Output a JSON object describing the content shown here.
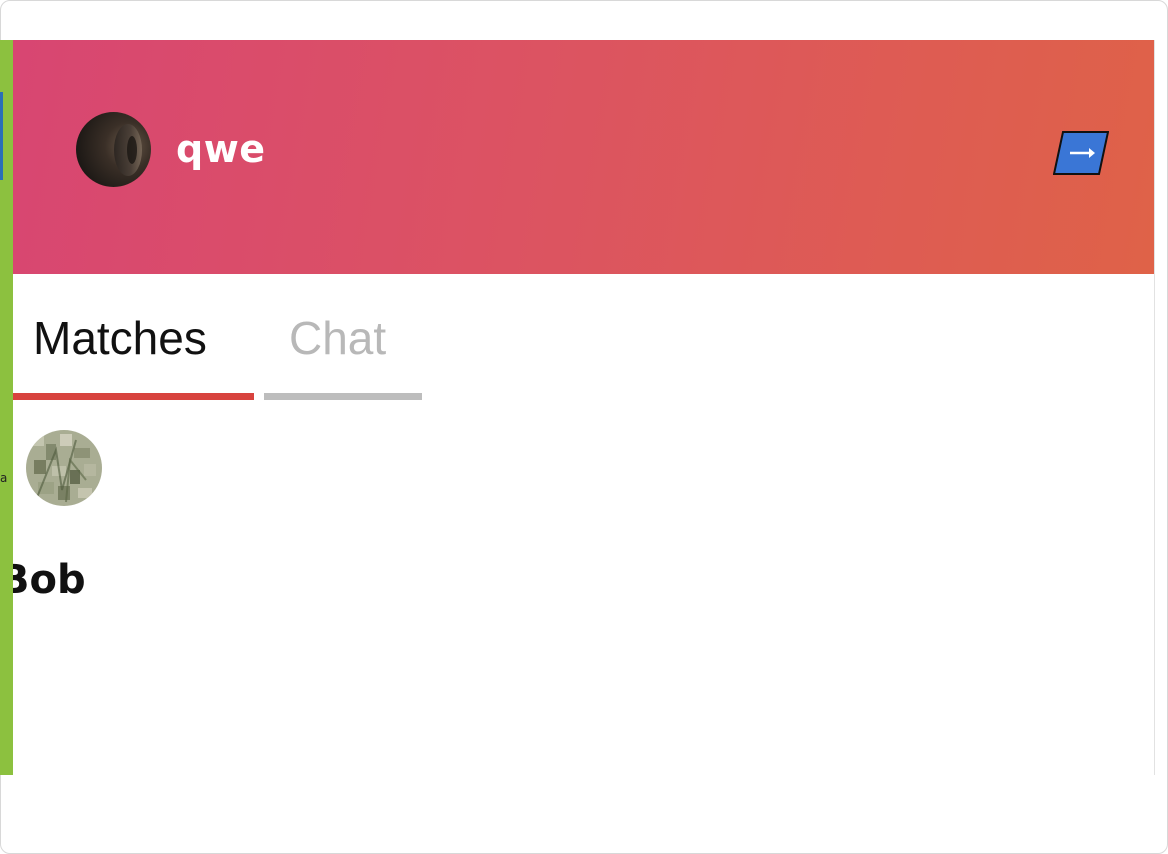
{
  "colors": {
    "header_gradient_start": "#d84672",
    "header_gradient_end": "#df6248",
    "active_tab_underline": "#d8433e",
    "inactive_tab_underline": "#bdbdbd",
    "inactive_tab_text": "#b8b8b8",
    "logout_button": "#3a76d6"
  },
  "header": {
    "user_name": "qwe",
    "avatar_icon": "user-avatar-photo",
    "logout_icon": "arrow-right-icon"
  },
  "tabs": [
    {
      "label": "Matches",
      "active": true
    },
    {
      "label": "Chat",
      "active": false
    }
  ],
  "matches": [
    {
      "name": "Bob",
      "avatar_icon": "match-avatar-photo"
    }
  ]
}
